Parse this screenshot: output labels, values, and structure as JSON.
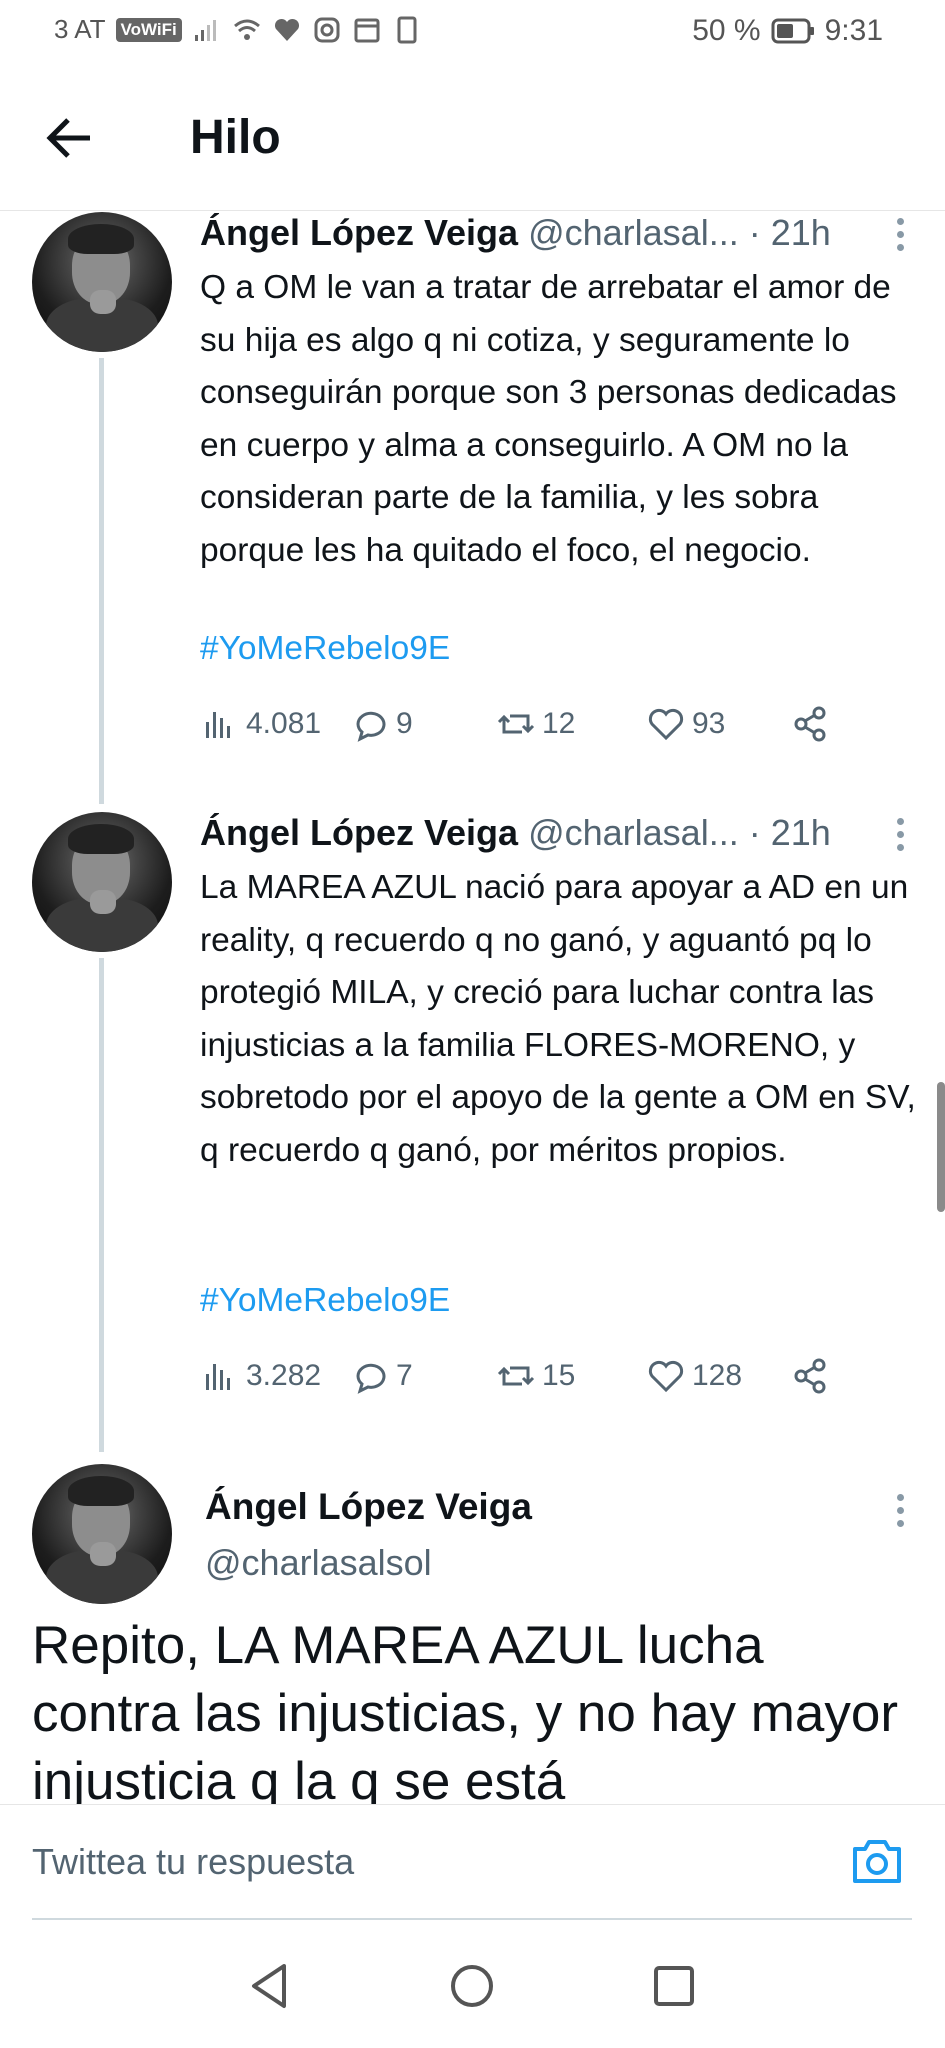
{
  "status_bar": {
    "carrier": "3 AT",
    "vowifi": "VoWiFi",
    "battery": "50 %",
    "time": "9:31"
  },
  "header": {
    "title": "Hilo"
  },
  "tweets": [
    {
      "name": "Ángel López Veiga",
      "handle": "@charlasal...",
      "time": "· 21h",
      "text": "Q a OM le van a tratar de arrebatar el amor de su hija es algo q ni cotiza, y seguramente lo conseguirán porque son 3 personas dedicadas en cuerpo y alma a conseguirlo. A OM no la consideran parte de la familia, y les sobra porque les ha quitado el foco, el negocio.",
      "hashtag": "#YoMeRebelo9E",
      "views": "4.081",
      "replies": "9",
      "retweets": "12",
      "likes": "93"
    },
    {
      "name": "Ángel López Veiga",
      "handle": "@charlasal...",
      "time": "· 21h",
      "text": "La MAREA AZUL nació para apoyar a AD en un reality, q recuerdo q no ganó, y aguantó pq lo protegió MILA, y creció para luchar contra las injusticias a la familia FLORES-MORENO, y sobretodo por el apoyo de la gente a OM en SV, q recuerdo q ganó, por méritos propios.",
      "hashtag": "#YoMeRebelo9E",
      "views": "3.282",
      "replies": "7",
      "retweets": "15",
      "likes": "128"
    }
  ],
  "focused_tweet": {
    "name": "Ángel López Veiga",
    "handle": "@charlasalsol",
    "text": "Repito, LA MAREA AZUL lucha contra las injusticias, y no hay mayor injusticia q la q se está"
  },
  "reply_bar": {
    "placeholder": "Twittea tu respuesta"
  },
  "icons": {
    "accent": "#1d9bf0"
  }
}
